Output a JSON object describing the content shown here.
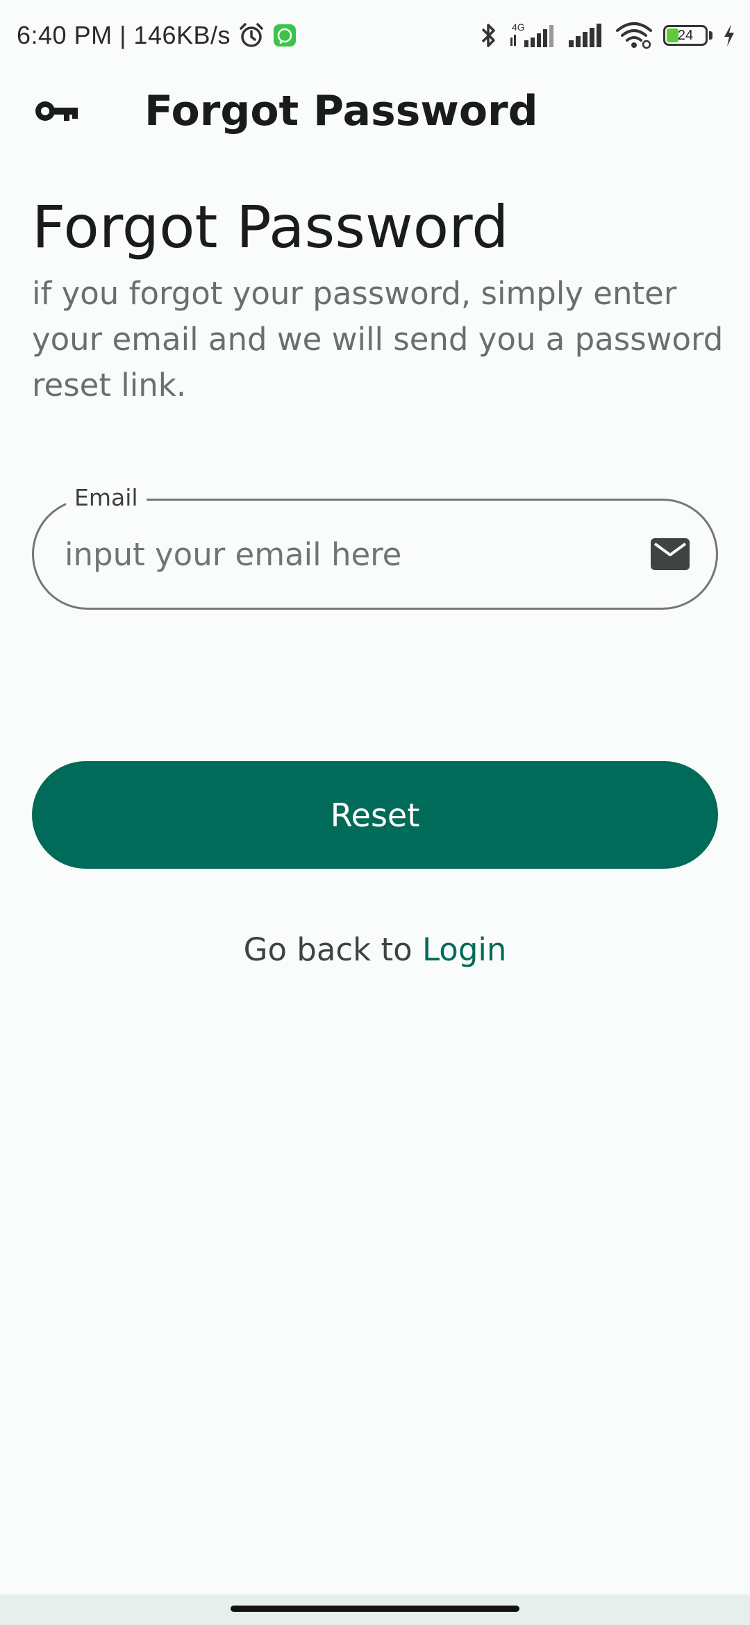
{
  "status_bar": {
    "time_speed": "6:40 PM | 146KB/s",
    "network_type": "4G",
    "battery_level": "24",
    "icons": [
      "alarm-icon",
      "whatsapp-icon",
      "bluetooth-icon",
      "signal-4g-icon",
      "signal-icon",
      "wifi-icon",
      "battery-icon",
      "charging-icon"
    ]
  },
  "app_bar": {
    "title": "Forgot Password",
    "icon": "key-icon"
  },
  "main": {
    "headline": "Forgot Password",
    "description": "if you forgot your password, simply enter your email and we will send you a password reset link.",
    "email_field": {
      "label": "Email",
      "placeholder": "input your email here",
      "value": "",
      "icon": "mail-icon"
    },
    "reset_button_label": "Reset",
    "back_text": "Go back to ",
    "login_link": "Login"
  },
  "colors": {
    "primary": "#006b58",
    "background": "#f9fcfa",
    "outline": "#747775"
  }
}
